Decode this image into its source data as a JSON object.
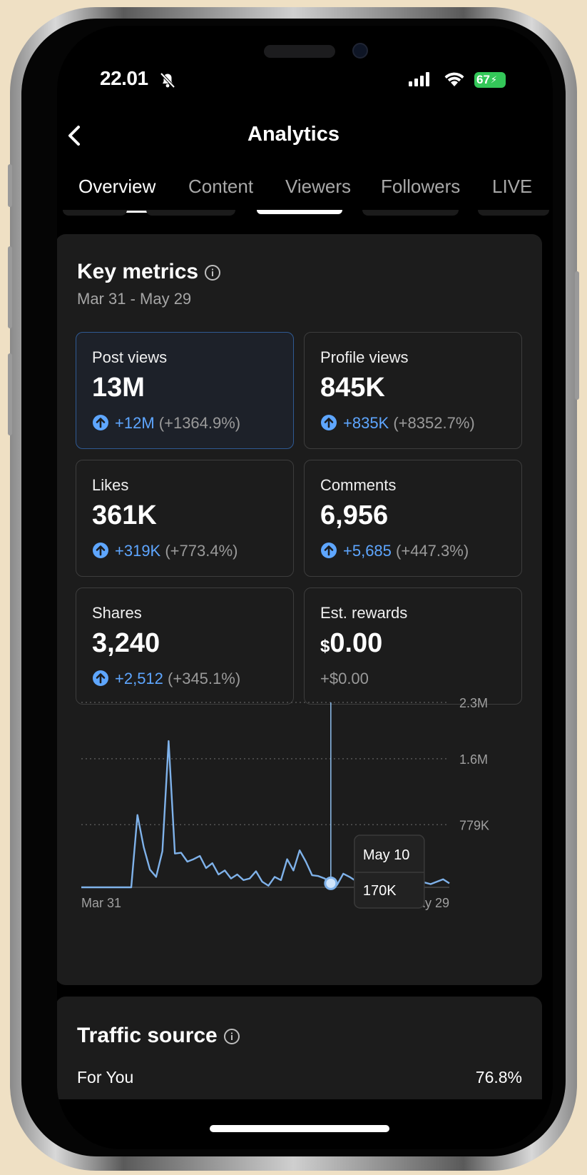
{
  "status_bar": {
    "time": "22.01",
    "battery": "67"
  },
  "nav": {
    "title": "Analytics"
  },
  "tabs": [
    {
      "label": "Overview",
      "active": true
    },
    {
      "label": "Content",
      "active": false
    },
    {
      "label": "Viewers",
      "active": false
    },
    {
      "label": "Followers",
      "active": false
    },
    {
      "label": "LIVE",
      "active": false
    }
  ],
  "key_metrics": {
    "title": "Key metrics",
    "date_range": "Mar 31 - May 29",
    "cards": [
      {
        "label": "Post views",
        "value": "13M",
        "change": "+12M",
        "pct": "(+1364.9%)",
        "selected": true
      },
      {
        "label": "Profile views",
        "value": "845K",
        "change": "+835K",
        "pct": "(+8352.7%)"
      },
      {
        "label": "Likes",
        "value": "361K",
        "change": "+319K",
        "pct": "(+773.4%)"
      },
      {
        "label": "Comments",
        "value": "6,956",
        "change": "+5,685",
        "pct": "(+447.3%)"
      },
      {
        "label": "Shares",
        "value": "3,240",
        "change": "+2,512",
        "pct": "(+345.1%)"
      },
      {
        "label": "Est. rewards",
        "currency": "$",
        "value": "0.00",
        "change_flat": "+$0.00"
      }
    ]
  },
  "chart_data": {
    "type": "line",
    "title": "",
    "xlabel": "",
    "ylabel": "",
    "x_tick_labels": [
      "Mar 31",
      "May 29"
    ],
    "y_tick_labels": [
      "2.3M",
      "1.6M",
      "779K"
    ],
    "y_ticks": [
      2300000,
      1600000,
      779000
    ],
    "ylim": [
      0,
      2300000
    ],
    "grid": true,
    "series": [
      {
        "values": [
          0,
          0,
          0,
          0,
          0,
          0,
          0,
          0,
          0,
          900000,
          500000,
          220000,
          130000,
          450000,
          1820000,
          420000,
          430000,
          320000,
          350000,
          390000,
          240000,
          300000,
          160000,
          210000,
          110000,
          160000,
          90000,
          110000,
          200000,
          70000,
          20000,
          130000,
          90000,
          350000,
          210000,
          460000,
          320000,
          150000,
          140000,
          110000,
          50000,
          30000,
          170000,
          130000,
          80000,
          40000,
          20000,
          10000,
          20000,
          20000,
          40000,
          50000,
          110000,
          60000,
          110000,
          60000,
          40000,
          70000,
          100000,
          50000
        ]
      }
    ],
    "tooltip": {
      "date": "May 10",
      "value": "170K",
      "index": 40
    }
  },
  "traffic_source": {
    "title": "Traffic source",
    "rows": [
      {
        "label": "For You",
        "pct_text": "76.8%",
        "pct": 76.8
      }
    ]
  }
}
